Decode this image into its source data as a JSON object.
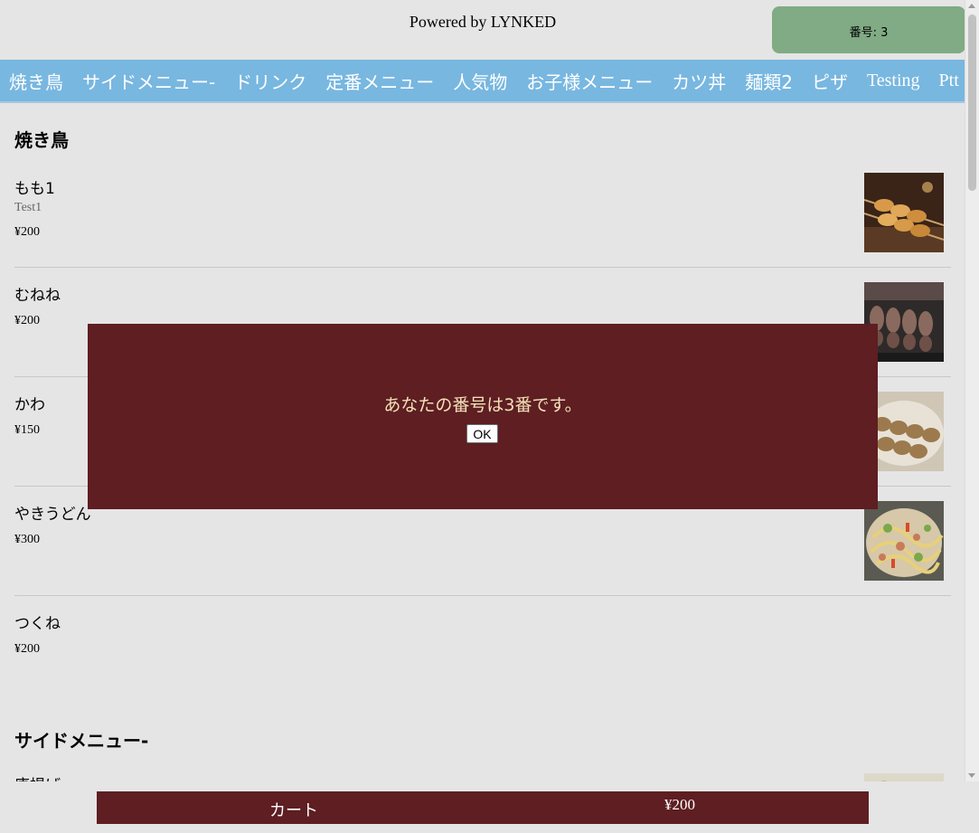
{
  "header": {
    "powered_by": "Powered by LYNKED",
    "ticket_label": "番号: 3"
  },
  "categories": [
    "焼き鳥",
    "サイドメニュー-",
    "ドリンク",
    "定番メニュー",
    "人気物",
    "お子様メニュー",
    "カツ丼",
    "麺類2",
    "ピザ",
    "Testing",
    "Ptt"
  ],
  "sections": [
    {
      "title": "焼き鳥",
      "items": [
        {
          "name": "もも1",
          "description": "Test1",
          "price": "¥200",
          "image": "skewers-image"
        },
        {
          "name": "むねね",
          "price": "¥200",
          "image": "grilled-skewers-image"
        },
        {
          "name": "かわ",
          "price": "¥150",
          "image": "chicken-skin-image"
        },
        {
          "name": "やきうどん",
          "price": "¥300",
          "image": "yaki-udon-image"
        },
        {
          "name": "つくね",
          "price": "¥200"
        }
      ]
    },
    {
      "title": "サイドメニュー-",
      "items": [
        {
          "name": "唐揚げ"
        }
      ]
    }
  ],
  "modal": {
    "message": "あなたの番号は3番です。",
    "ok_label": "OK"
  },
  "cart": {
    "label": "カート",
    "total": "¥200"
  },
  "colors": {
    "nav_bg": "#78b7e0",
    "ticket_bg": "#80ab84",
    "modal_bg": "#5e1e22",
    "modal_text": "#f3e1b8",
    "cart_bg": "#5e1e22",
    "page_bg": "#e5e5e5"
  }
}
